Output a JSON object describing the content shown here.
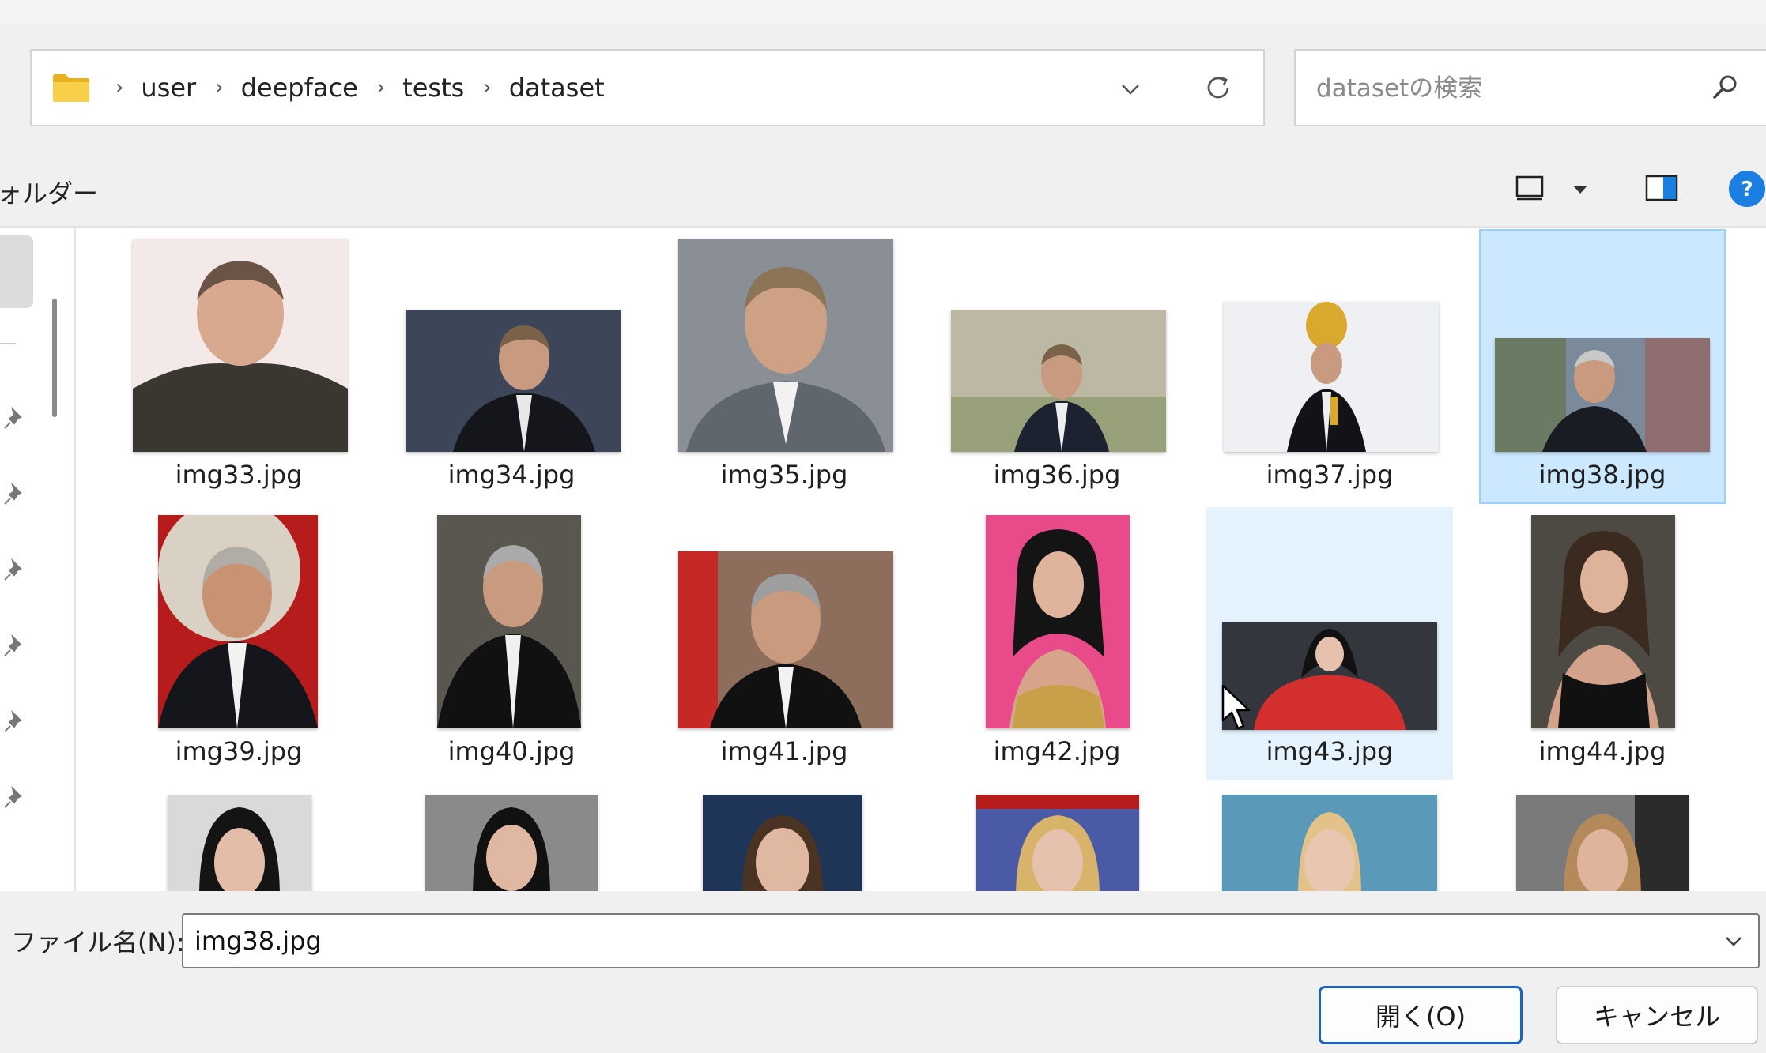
{
  "breadcrumb": {
    "items": [
      "user",
      "deepface",
      "tests",
      "dataset"
    ]
  },
  "search": {
    "placeholder": "datasetの検索"
  },
  "toolbar": {
    "label": "ォルダー"
  },
  "files": [
    {
      "name": "img33.jpg"
    },
    {
      "name": "img34.jpg"
    },
    {
      "name": "img35.jpg"
    },
    {
      "name": "img36.jpg"
    },
    {
      "name": "img37.jpg"
    },
    {
      "name": "img38.jpg"
    },
    {
      "name": "img39.jpg"
    },
    {
      "name": "img40.jpg"
    },
    {
      "name": "img41.jpg"
    },
    {
      "name": "img42.jpg"
    },
    {
      "name": "img43.jpg"
    },
    {
      "name": "img44.jpg"
    }
  ],
  "selected_file": "img38.jpg",
  "hovered_file": "img43.jpg",
  "filename": {
    "label": "ファイル名(N):",
    "value": "img38.jpg"
  },
  "buttons": {
    "open": "開く(O)",
    "cancel": "キャンセル"
  },
  "colors": {
    "selection": "#cce8ff",
    "hover": "#e5f3ff",
    "accent": "#1a64c8",
    "help": "#1a7fe0",
    "folder": "#f4c430"
  },
  "icons": [
    "folder-icon",
    "chevron-down-icon",
    "refresh-icon",
    "search-icon",
    "view-icon",
    "preview-pane-icon",
    "help-icon",
    "pin-icon",
    "mouse-cursor"
  ]
}
